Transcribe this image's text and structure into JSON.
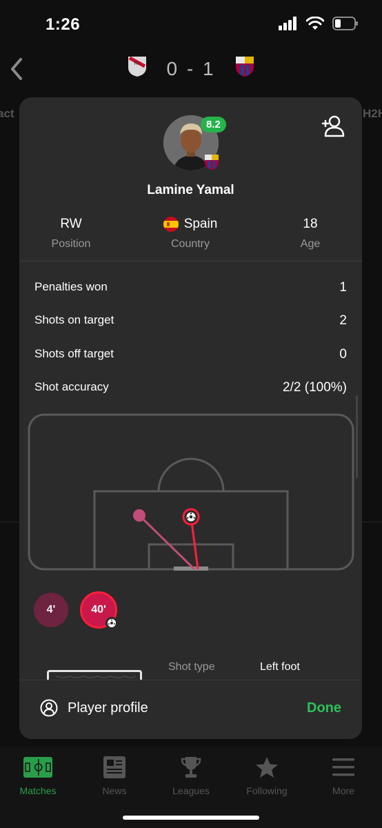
{
  "status_bar": {
    "time": "1:26"
  },
  "match": {
    "score": "0 - 1"
  },
  "background": {
    "left_tab_fragment": "act",
    "right_tab_fragment": "H2H"
  },
  "player": {
    "name": "Lamine Yamal",
    "rating": "8.2",
    "position": {
      "value": "RW",
      "label": "Position"
    },
    "country": {
      "value": "Spain",
      "label": "Country"
    },
    "age": {
      "value": "18",
      "label": "Age"
    }
  },
  "stats": [
    {
      "label": "Penalties won",
      "value": "1"
    },
    {
      "label": "Shots on target",
      "value": "2"
    },
    {
      "label": "Shots off target",
      "value": "0"
    },
    {
      "label": "Shot accuracy",
      "value": "2/2 (100%)"
    }
  ],
  "shots": [
    {
      "minute": "4'",
      "selected": false,
      "goal": false
    },
    {
      "minute": "40'",
      "selected": true,
      "goal": true
    }
  ],
  "shot_detail": {
    "type_label": "Shot type",
    "type_value": "Left foot"
  },
  "footer": {
    "player_profile": "Player profile",
    "done": "Done"
  },
  "tabs": [
    {
      "label": "Matches",
      "icon": "pitch-icon",
      "active": true
    },
    {
      "label": "News",
      "icon": "newspaper-icon",
      "active": false
    },
    {
      "label": "Leagues",
      "icon": "trophy-icon",
      "active": false
    },
    {
      "label": "Following",
      "icon": "star-icon",
      "active": false
    },
    {
      "label": "More",
      "icon": "menu-icon",
      "active": false
    }
  ],
  "colors": {
    "accent_green": "#2ec05a",
    "rating_green": "#25b34a",
    "goal_red": "#ff1f3c",
    "shot_pink": "#c24d7a",
    "modal_bg": "#2b2b2b"
  }
}
